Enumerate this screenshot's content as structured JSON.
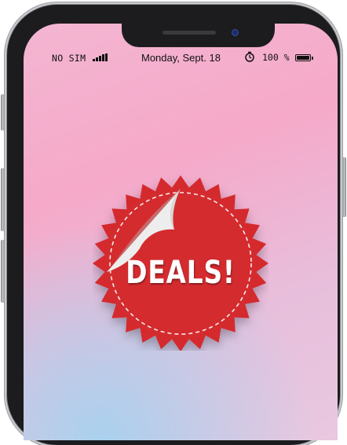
{
  "status_bar": {
    "carrier": "NO SIM",
    "signal_icon": "signal-bars-icon",
    "datetime": "Monday, Sept. 18",
    "alarm_icon": "alarm-clock-icon",
    "battery_percent": "100 %",
    "battery_level": 1.0,
    "battery_icon": "battery-icon"
  },
  "sticker": {
    "label": "DEALS!",
    "shape": "starburst-seal",
    "color": "#d42b2f",
    "peel_color": "#ededed"
  },
  "background": {
    "colors": [
      "#f6a9c9",
      "#e7bfdc",
      "#a9d1ee"
    ]
  }
}
